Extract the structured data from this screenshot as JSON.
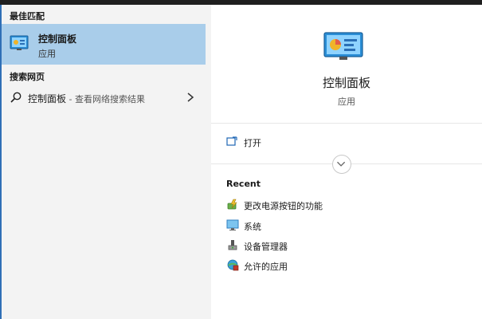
{
  "left": {
    "best_match_title": "最佳匹配",
    "best_match": {
      "name": "控制面板",
      "type": "应用"
    },
    "web_title": "搜索网页",
    "web_result": {
      "query": "控制面板",
      "hint": " - 查看网络搜索结果"
    }
  },
  "right": {
    "title": "控制面板",
    "subtitle": "应用",
    "open_label": "打开",
    "recent_title": "Recent",
    "recent_items": [
      {
        "label": "更改电源按钮的功能",
        "icon": "power-options-icon"
      },
      {
        "label": "系统",
        "icon": "system-monitor-icon"
      },
      {
        "label": "设备管理器",
        "icon": "device-manager-icon"
      },
      {
        "label": "允许的应用",
        "icon": "firewall-apps-icon"
      }
    ]
  },
  "colors": {
    "selection": "#a9cdea",
    "accent": "#2f6fb6",
    "pane_left": "#f3f3f3",
    "pane_right": "#ffffff"
  }
}
